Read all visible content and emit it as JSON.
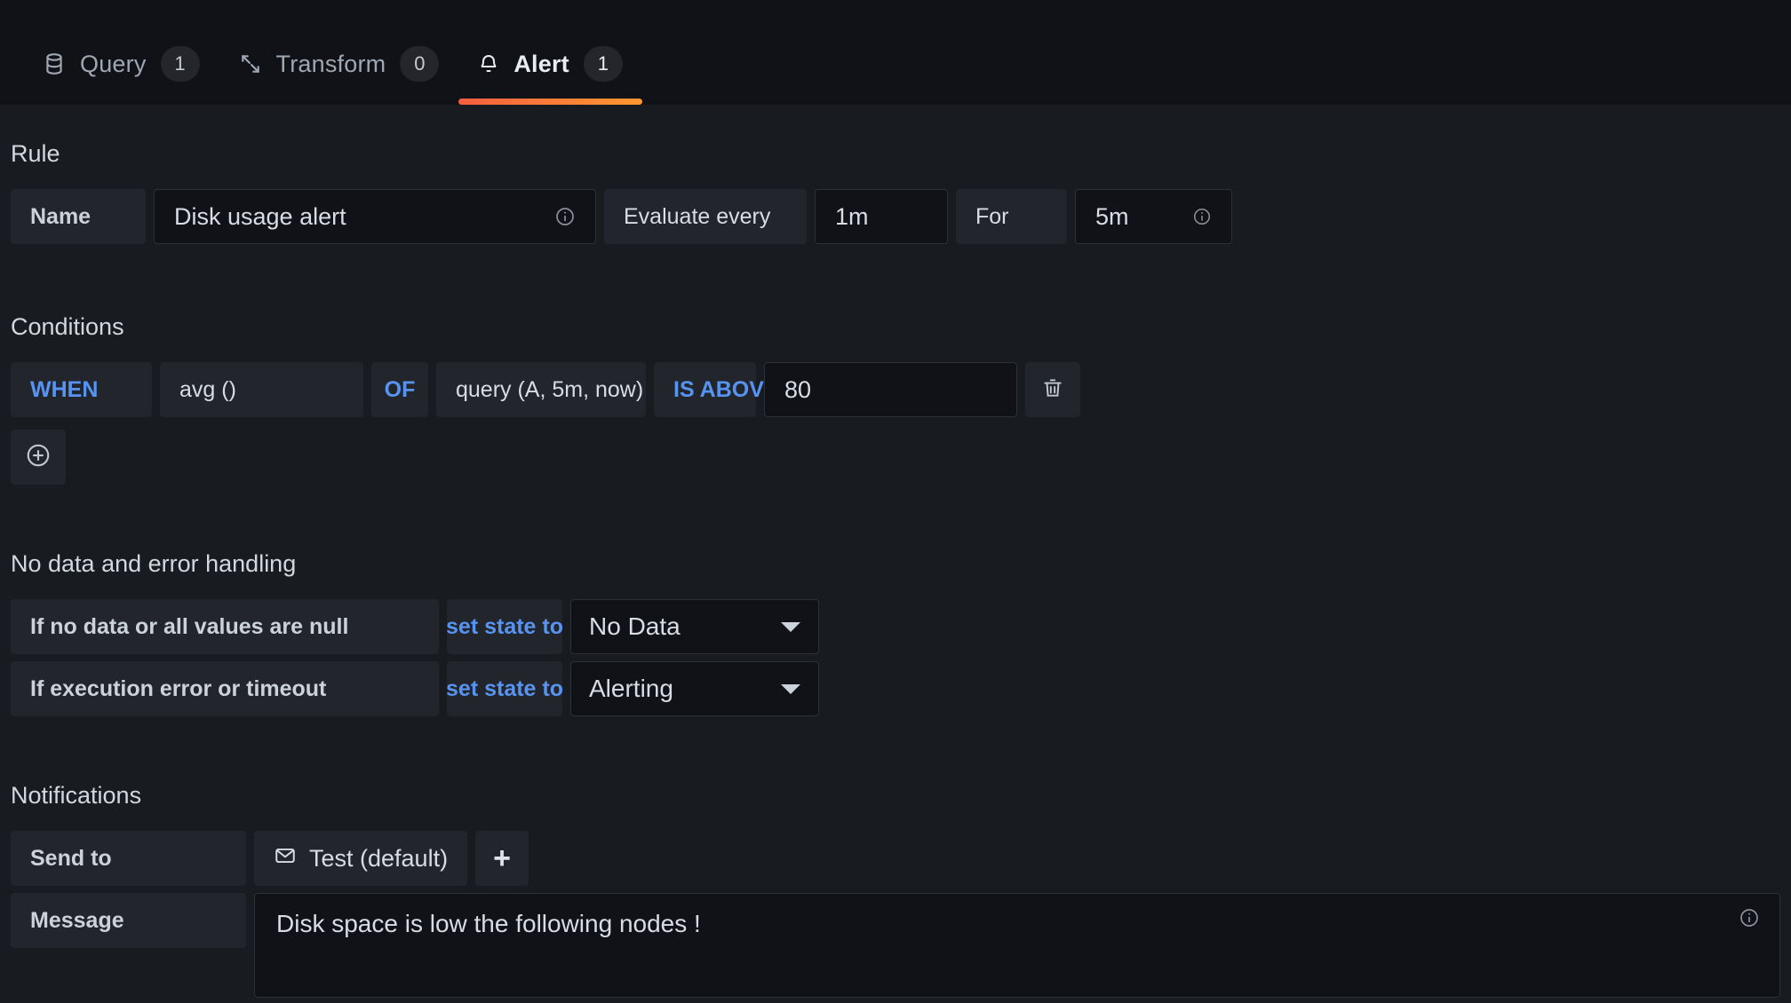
{
  "tabs": [
    {
      "label": "Query",
      "count": "1",
      "icon": "database-icon",
      "active": false
    },
    {
      "label": "Transform",
      "count": "0",
      "icon": "transform-icon",
      "active": false
    },
    {
      "label": "Alert",
      "count": "1",
      "icon": "bell-icon",
      "active": true
    }
  ],
  "rule": {
    "title": "Rule",
    "name_label": "Name",
    "name_value": "Disk usage alert",
    "evaluate_label": "Evaluate every",
    "evaluate_value": "1m",
    "for_label": "For",
    "for_value": "5m"
  },
  "conditions": {
    "title": "Conditions",
    "rows": [
      {
        "when": "WHEN",
        "reducer": "avg ()",
        "of": "OF",
        "query": "query (A, 5m, now)",
        "evaluator": "IS ABOVE",
        "threshold": "80"
      }
    ],
    "delete_icon": "trash-icon",
    "add_icon": "plus-circle-icon"
  },
  "nodata": {
    "title": "No data and error handling",
    "rows": [
      {
        "label": "If no data or all values are null",
        "verb": "set state to",
        "state": "No Data"
      },
      {
        "label": "If execution error or timeout",
        "verb": "set state to",
        "state": "Alerting"
      }
    ]
  },
  "notifications": {
    "title": "Notifications",
    "send_to_label": "Send to",
    "channel": "Test (default)",
    "channel_icon": "envelope-icon",
    "add_label": "+",
    "message_label": "Message",
    "message_value": "Disk space is low the following nodes !"
  },
  "colors": {
    "accent_blue": "#5794f2",
    "tab_underline_start": "#f55f3e",
    "tab_underline_end": "#ff9830",
    "page_bg": "#181b1f",
    "input_bg": "#111217",
    "label_bg": "#22252b"
  }
}
